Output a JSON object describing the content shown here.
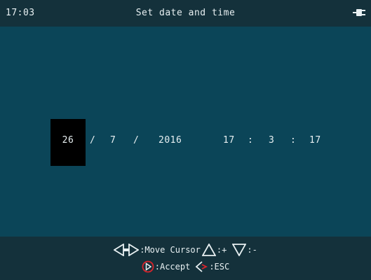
{
  "header": {
    "clock": "17:03",
    "title": "Set date and time",
    "power_icon": "plug-icon"
  },
  "datetime": {
    "day": "26",
    "sep1": "/",
    "month": "7",
    "sep2": "/",
    "year": "2016",
    "hour": "17",
    "sep3": ":",
    "minute": "3",
    "sep4": ":",
    "second": "17",
    "selected_field": "day"
  },
  "footer": {
    "move_cursor_label": ":Move Cursor",
    "plus_label": ":+",
    "minus_label": ":-",
    "accept_label": ":Accept",
    "esc_label": ":ESC",
    "icons": [
      "left-right-arrows-icon",
      "up-triangle-icon",
      "down-triangle-icon",
      "accept-play-icon",
      "back-arrow-icon"
    ]
  },
  "colors": {
    "background": "#0b4558",
    "bar": "#14313b",
    "selection": "#000000",
    "text": "#e8f0f2",
    "accept_ring": "#d8242c"
  }
}
